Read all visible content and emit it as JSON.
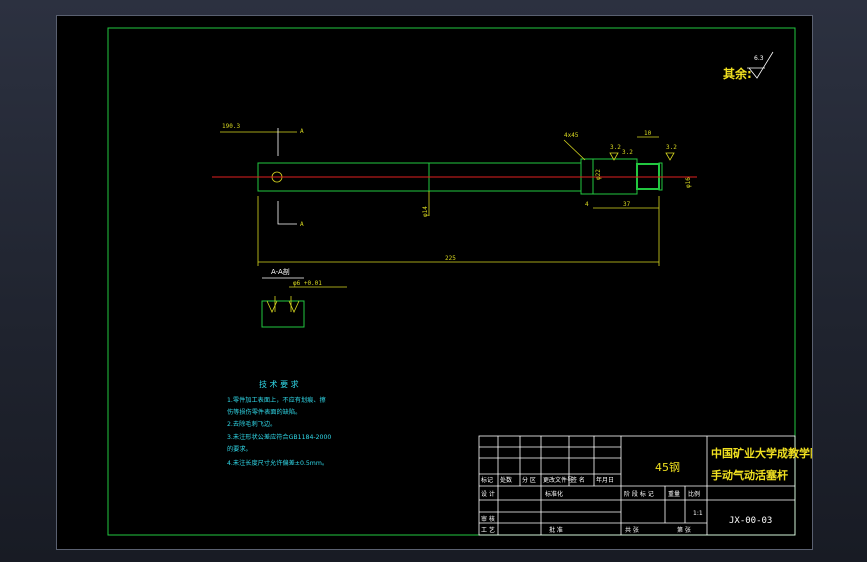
{
  "roughness": {
    "label": "其余:",
    "value": "6.3"
  },
  "dims": {
    "d1": "190.3",
    "section_mark": "A",
    "d_chamfer": "4x45",
    "d_ra1": "3.2",
    "d_ra2": "3.2",
    "d_width": "10",
    "d_ra3": "3.2",
    "d_diam_small": "φ22",
    "d_diam_right": "φ16",
    "d_diam_main": "φ14",
    "d_4": "4",
    "d_37": "37",
    "d_total": "225",
    "tol": "0.8"
  },
  "section": {
    "title": "A-A剖",
    "tol": "φ6 +0.01"
  },
  "tech": {
    "title": "技 术 要 求",
    "lines": [
      "1.零件加工表面上，不应有划痕、擦",
      "伤等损伤零件表面的缺陷。",
      "2.去除毛刺飞边。",
      "3.未注形状公差应符合GB1184-2000",
      "的要求。",
      "4.未注长度尺寸允许偏差±0.5mm。"
    ]
  },
  "titleblock": {
    "material": "45钢",
    "school": "中国矿业大学成教学院",
    "part": "手动气动活塞杆",
    "drawing_no": "JX-00-03",
    "headers": [
      "标记",
      "处数",
      "分 区",
      "更改文件号",
      "签 名",
      "年月日"
    ],
    "row2": [
      "设 计",
      "标准化"
    ],
    "right_headers": [
      "阶 段 标 记",
      "重量",
      "比例"
    ],
    "scale": "1:1",
    "row_review": "审 核",
    "row_process": "工 艺",
    "approve": "批 准",
    "sheets": "共  张",
    "sheet": "第  张"
  }
}
